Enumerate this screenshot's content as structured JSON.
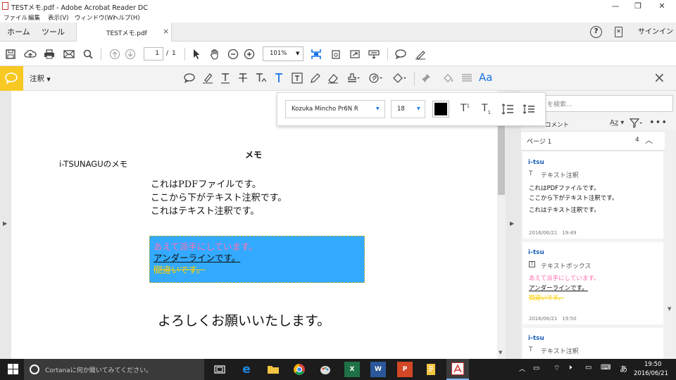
{
  "window": {
    "title": "TESTメモ.pdf - Adobe Acrobat Reader DC"
  },
  "menu": [
    "ファイル",
    "編集",
    "表示(V)",
    "ウィンドウ(W)",
    "ヘルプ(H)"
  ],
  "tabs": {
    "home": "ホーム",
    "tools": "ツール",
    "doc": "TESTメモ.pdf",
    "close": "×",
    "signin": "サインイン"
  },
  "toolbar": {
    "page_current": "1",
    "page_sep": "/",
    "page_total": "1",
    "zoom": "101%"
  },
  "comment_bar": {
    "label": "注釈",
    "close": "×"
  },
  "font_popup": {
    "font": "Kozuka Mincho Pr6N R",
    "size": "18",
    "color": "#000000",
    "aa": "Aa"
  },
  "document": {
    "title": "メモ",
    "subtitle": "i-TSUNAGUのメモ",
    "lines": [
      "これはPDFファイルです。",
      "ここから下がテキスト注釈です。",
      "これはテキスト注釈です。"
    ],
    "box": {
      "line1": "あえて派手にしています。",
      "line2": "アンダーラインです。",
      "line3": "間違いです。"
    },
    "closing": "よろしくお願いいたします。"
  },
  "panel": {
    "search_placeholder": "を検索...",
    "comments_label": "コメント",
    "page_label": "ページ 1",
    "page_count": "4",
    "comments": [
      {
        "author": "i-tsu",
        "type": "テキスト注釈",
        "lines": [
          "これはPDFファイルです。",
          "ここから下がテキスト注釈です。",
          "これはテキスト注釈です。"
        ],
        "date": "2016/06/21　19:49"
      },
      {
        "author": "i-tsu",
        "type": "テキストボックス",
        "lines": [
          "あえて派手にしています。",
          "アンダーラインです。",
          "間違いです。"
        ],
        "date": "2016/06/21　19:50"
      },
      {
        "author": "i-tsu",
        "type": "テキスト注釈"
      }
    ]
  },
  "taskbar": {
    "cortana": "Cortanaに何か聞いてみてください。",
    "ime": "あ",
    "time": "19:50",
    "date": "2016/06/21"
  },
  "colors": {
    "accent": "#1473e6",
    "comment_yellow": "#f8c823",
    "box_fill": "#33aaff",
    "pink_text": "#ff70b0",
    "yellow_text": "#ffd000"
  }
}
